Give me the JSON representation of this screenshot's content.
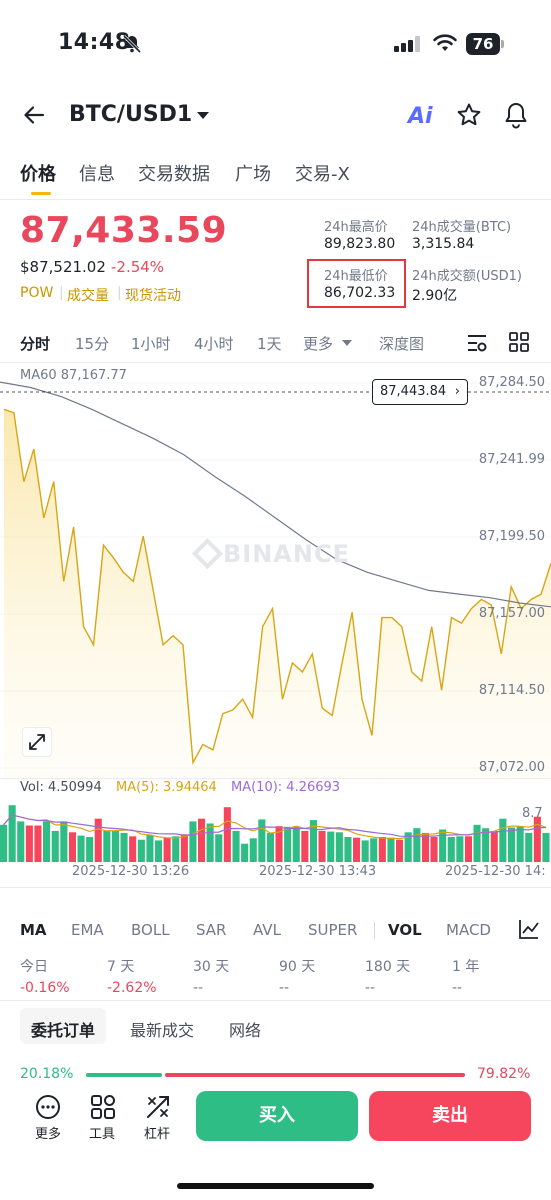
{
  "status_bar": {
    "time": "14:48",
    "battery": "76",
    "icons": [
      "bell-slash-icon",
      "signal-icon",
      "wifi-icon",
      "battery-icon"
    ]
  },
  "header": {
    "pair": "BTC/USD1",
    "ai_label": "Ai",
    "icons": [
      "back-arrow-icon",
      "caret-down-icon",
      "star-icon",
      "bell-icon"
    ]
  },
  "tabs": [
    {
      "label": "价格",
      "active": true
    },
    {
      "label": "信息"
    },
    {
      "label": "交易数据"
    },
    {
      "label": "广场"
    },
    {
      "label": "交易-X"
    }
  ],
  "price": {
    "last": "87,433.59",
    "usd": "$87,521.02",
    "change": "-2.54%",
    "tags": [
      "POW",
      "成交量",
      "现货活动"
    ]
  },
  "stats": {
    "high_label": "24h最高价",
    "high": "89,823.80",
    "vol_btc_label": "24h成交量(BTC)",
    "vol_btc": "3,315.84",
    "low_label": "24h最低价",
    "low": "86,702.33",
    "vol_usd_label": "24h成交额(USD1)",
    "vol_usd": "2.90亿"
  },
  "timeframes": [
    "分时",
    "15分",
    "1小时",
    "4小时",
    "1天",
    "更多",
    "深度图"
  ],
  "chart": {
    "ma60": "MA60 87,167.77",
    "current_tag": "87,443.84",
    "watermark": "BINANCE",
    "y_labels": [
      "87,284.50",
      "87,241.99",
      "87,199.50",
      "87,157.00",
      "87,114.50",
      "87,072.00"
    ],
    "colors": {
      "line": "#d9a514",
      "ma": "#707a8a",
      "up": "#2ebd85",
      "down": "#f6465d"
    }
  },
  "chart_data": {
    "type": "area",
    "ylim": [
      87072.0,
      87284.5
    ],
    "price": [
      87270,
      87268,
      87230,
      87248,
      87210,
      87230,
      87175,
      87205,
      87150,
      87140,
      87195,
      87188,
      87180,
      87175,
      87200,
      87170,
      87140,
      87145,
      87140,
      87075,
      87085,
      87082,
      87102,
      87104,
      87110,
      87100,
      87150,
      87160,
      87110,
      87130,
      87125,
      87135,
      87105,
      87101,
      87130,
      87158,
      87110,
      87090,
      87155,
      87155,
      87150,
      87125,
      87120,
      87150,
      87115,
      87155,
      87152,
      87160,
      87165,
      87162,
      87135,
      87172,
      87160,
      87165,
      87168,
      87185
    ],
    "ma60": [
      87285,
      87282,
      87277,
      87270,
      87262,
      87254,
      87245,
      87233,
      87222,
      87210,
      87198,
      87187,
      87180,
      87175,
      87170,
      87168,
      87166,
      87163,
      87161
    ],
    "volume": {
      "vol": "Vol: 4.50994",
      "ma5": "MA(5): 3.94464",
      "ma10": "MA(10): 4.26693",
      "axis_max": "8.7",
      "bars": [
        5.5,
        8.4,
        6.0,
        5.4,
        5.4,
        6.0,
        4.6,
        6.0,
        4.4,
        3.9,
        3.7,
        6.4,
        4.6,
        4.6,
        4.3,
        3.8,
        3.3,
        4.0,
        3.2,
        3.6,
        3.8,
        4.1,
        6.0,
        6.4,
        5.7,
        4.1,
        8.1,
        4.6,
        2.7,
        3.5,
        6.3,
        4.3,
        5.3,
        5.2,
        5.3,
        4.6,
        6.2,
        4.6,
        4.5,
        4.4,
        3.7,
        3.6,
        3.2,
        3.5,
        3.7,
        3.6,
        3.3,
        4.4,
        5.0,
        4.3,
        3.7,
        4.8,
        3.7,
        3.8,
        3.8,
        5.5,
        5.0,
        4.6,
        6.4,
        5.1,
        5.3,
        4.3,
        6.7,
        4.3
      ],
      "up": [
        1,
        1,
        1,
        0,
        0,
        1,
        1,
        1,
        0,
        1,
        1,
        0,
        1,
        1,
        1,
        0,
        1,
        1,
        1,
        0,
        1,
        0,
        1,
        0,
        1,
        1,
        0,
        1,
        1,
        1,
        1,
        1,
        0,
        1,
        1,
        0,
        1,
        0,
        1,
        1,
        1,
        0,
        1,
        1,
        0,
        1,
        0,
        1,
        1,
        0,
        0,
        1,
        1,
        1,
        0,
        1,
        1,
        0,
        1,
        1,
        1,
        1,
        0,
        1
      ]
    },
    "x_labels": [
      "2025-12-30 13:26",
      "2025-12-30 13:43",
      "2025-12-30 14:"
    ]
  },
  "indicators": [
    "MA",
    "EMA",
    "BOLL",
    "SAR",
    "AVL",
    "SUPER",
    "VOL",
    "MACD"
  ],
  "performance": [
    {
      "label": "今日",
      "value": "-0.16%"
    },
    {
      "label": "7 天",
      "value": "-2.62%"
    },
    {
      "label": "30 天",
      "value": "--"
    },
    {
      "label": "90 天",
      "value": "--"
    },
    {
      "label": "180 天",
      "value": "--"
    },
    {
      "label": "1 年",
      "value": "--"
    }
  ],
  "order_tabs": [
    "委托订单",
    "最新成交",
    "网络"
  ],
  "ratio": {
    "buy": "20.18%",
    "sell": "79.82%",
    "buy_fraction": 0.2018
  },
  "bottom": {
    "more": "更多",
    "tools": "工具",
    "leverage": "杠杆",
    "buy": "买入",
    "sell": "卖出"
  }
}
